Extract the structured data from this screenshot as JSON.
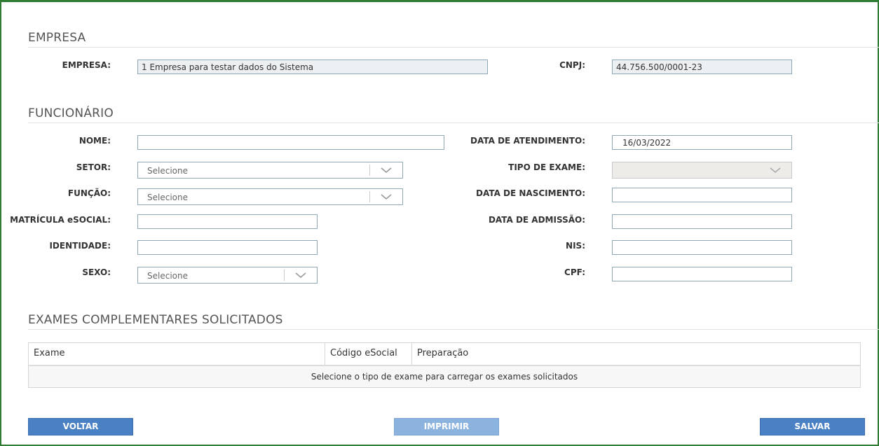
{
  "empresa_section": {
    "title": "EMPRESA",
    "empresa_label": "EMPRESA:",
    "empresa_value": "1 Empresa para testar dados do Sistema",
    "cnpj_label": "CNPJ:",
    "cnpj_value": "44.756.500/0001-23"
  },
  "funcionario_section": {
    "title": "FUNCIONÁRIO",
    "nome_label": "NOME:",
    "nome_value": "",
    "setor_label": "SETOR:",
    "setor_value": "Selecione",
    "funcao_label": "FUNÇÃO:",
    "funcao_value": "Selecione",
    "matricula_label": "MATRÍCULA eSOCIAL:",
    "matricula_value": "",
    "identidade_label": "IDENTIDADE:",
    "identidade_value": "",
    "sexo_label": "SEXO:",
    "sexo_value": "Selecione",
    "data_atendimento_label": "DATA DE ATENDIMENTO:",
    "data_atendimento_value": "16/03/2022",
    "tipo_exame_label": "TIPO DE EXAME:",
    "tipo_exame_value": "",
    "data_nascimento_label": "DATA DE NASCIMENTO:",
    "data_nascimento_value": "",
    "data_admissao_label": "DATA DE ADMISSÃO:",
    "data_admissao_value": "",
    "nis_label": "NIS:",
    "nis_value": "",
    "cpf_label": "CPF:",
    "cpf_value": ""
  },
  "exames_section": {
    "title": "EXAMES COMPLEMENTARES SOLICITADOS",
    "columns": [
      "Exame",
      "Código eSocial",
      "Preparação"
    ],
    "empty_message": "Selecione o tipo de exame para carregar os exames solicitados"
  },
  "actions": {
    "voltar_label": "VOLTAR",
    "imprimir_label": "IMPRIMIR",
    "salvar_label": "SALVAR"
  },
  "colors": {
    "accent_button": "#4a80c4",
    "disabled_button": "#8cb3de",
    "frame_border": "#2e7d32"
  },
  "icons": {
    "dropdown": "chevron-down-icon"
  }
}
